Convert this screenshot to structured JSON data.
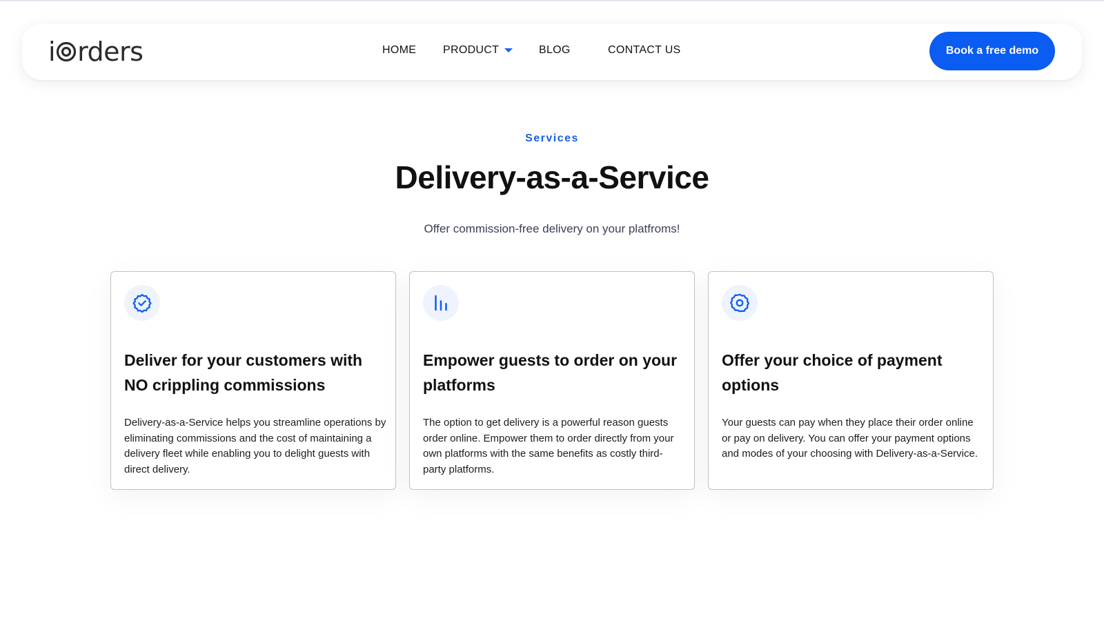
{
  "header": {
    "logo": {
      "prefix": "i",
      "suffix": "rders"
    },
    "nav": [
      {
        "label": "HOME"
      },
      {
        "label": "PRODUCT"
      },
      {
        "label": "BLOG"
      },
      {
        "label": "CONTACT US"
      }
    ],
    "cta": "Book a free demo"
  },
  "hero": {
    "eyebrow": "Services",
    "title": "Delivery-as-a-Service",
    "subtitle": "Offer commission-free delivery on your platfroms!"
  },
  "cards": [
    {
      "icon": "verified-badge-icon",
      "title": "Deliver for your customers with NO crippling commissions",
      "text": "Delivery-as-a-Service helps you streamline operations by eliminating commissions and the cost of maintaining a delivery fleet while enabling you to delight guests with direct delivery."
    },
    {
      "icon": "bar-chart-icon",
      "title": "Empower guests to order on your platforms",
      "text": "The option to get delivery is a powerful reason guests order online. Empower them to order directly from your own platforms with the same benefits as costly third-party platforms."
    },
    {
      "icon": "gear-icon",
      "title": "Offer your choice of payment options",
      "text": "Your guests can pay when they place their order online or pay on delivery. You can offer your payment options and modes of your choosing with Delivery-as-a-Service."
    }
  ],
  "colors": {
    "accent": "#0b5cf0",
    "eyebrow": "#1a5fe0",
    "icon_bg": "#eef3fd"
  }
}
